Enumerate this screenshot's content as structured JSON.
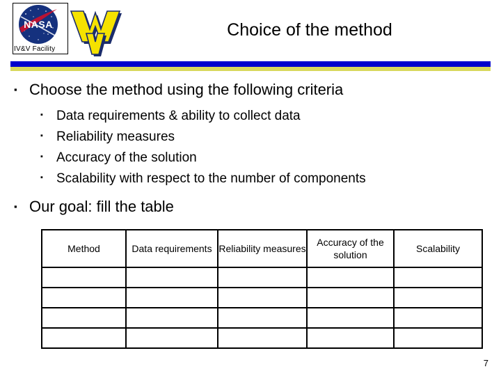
{
  "slide": {
    "title": "Choice of the method",
    "page_number": "7"
  },
  "branding": {
    "nasa_logo_name": "nasa-meatball-logo",
    "nasa_wordmark": "NASA",
    "facility_label": "IV&V Facility",
    "wvu_logo_name": "wvu-flying-wv-logo",
    "bar_blue": "#0000CC",
    "bar_gold": "#D8D85C",
    "nasa_blue": "#1A3C8C",
    "nasa_red": "#B5123E",
    "wvu_gold": "#F5E200",
    "wvu_navy": "#1B2C6B"
  },
  "bullets": {
    "glyph": "▪",
    "level1": [
      {
        "text": "Choose the method using the following criteria"
      },
      {
        "text": "Our goal: fill the table"
      }
    ],
    "level2": [
      {
        "text": "Data requirements & ability to collect data"
      },
      {
        "text": "Reliability measures"
      },
      {
        "text": "Accuracy of the solution"
      },
      {
        "text": "Scalability with respect to the number of components"
      }
    ]
  },
  "table": {
    "headers": [
      "Method",
      "Data requirements",
      "Reliability measures",
      "Accuracy of the solution",
      "Scalability"
    ],
    "rows": [
      [
        "",
        "",
        "",
        "",
        ""
      ],
      [
        "",
        "",
        "",
        "",
        ""
      ],
      [
        "",
        "",
        "",
        "",
        ""
      ],
      [
        "",
        "",
        "",
        "",
        ""
      ]
    ]
  }
}
